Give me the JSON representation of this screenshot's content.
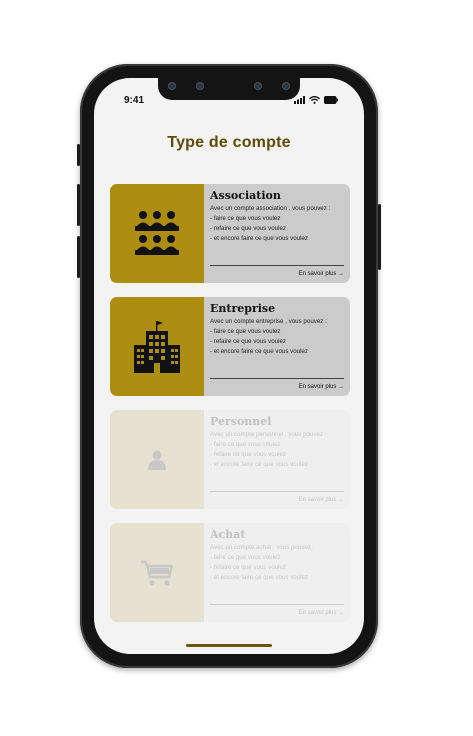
{
  "status": {
    "time": "9:41"
  },
  "page": {
    "title": "Type de compte"
  },
  "cards": [
    {
      "title": "Association",
      "intro": "Avec un compte association , vous pouvez :",
      "lines": [
        "- faire ce que vous voulez",
        "- refaire ce que vous voulez",
        "- et encore faire ce que vous voulez"
      ],
      "more": "En savoir plus →",
      "icon": "group-icon"
    },
    {
      "title": "Entreprise",
      "intro": "Avec un compte entreprise , vous pouvez :",
      "lines": [
        "- faire ce que vous voulez",
        "- refaire ce que vous voulez",
        "- et encore faire ce que vous voulez"
      ],
      "more": "En savoir plus →",
      "icon": "building-icon"
    },
    {
      "title": "Personnel",
      "intro": "Avec un compte personnel , vous pouvez :",
      "lines": [
        "- faire ce que vous voulez",
        "- refaire ce que vous voulez",
        "- et encore faire ce que vous voulez"
      ],
      "more": "En savoir plus →",
      "icon": "person-icon"
    },
    {
      "title": "Achat",
      "intro": "Avec un compte achat , vous pouvez :",
      "lines": [
        "- faire ce que vous voulez",
        "- refaire ce que vous voulez",
        "- et encore faire ce que vous voulez"
      ],
      "more": "En savoir plus →",
      "icon": "cart-icon"
    }
  ]
}
